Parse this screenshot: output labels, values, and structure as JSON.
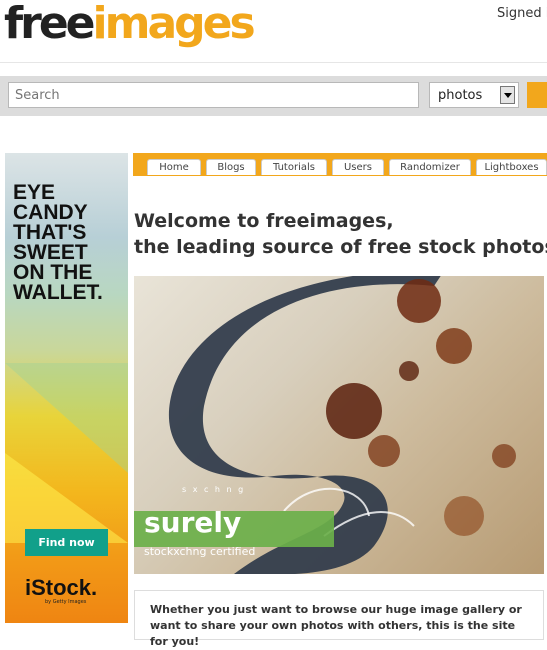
{
  "header": {
    "logo_free": "free",
    "logo_images": "images",
    "signed_in": "Signed i"
  },
  "search": {
    "placeholder": "Search",
    "type_selected": "photos"
  },
  "ad": {
    "headline": "EYE\nCANDY\nTHAT'S\nSWEET\nON THE\nWALLET.",
    "button_label": "Find now",
    "brand": "iStock.",
    "brand_sub": "by Getty Images"
  },
  "nav": {
    "tabs": [
      "Home",
      "Blogs",
      "Tutorials",
      "Users",
      "Randomizer",
      "Lightboxes"
    ]
  },
  "main": {
    "welcome_line1": "Welcome to freeimages,",
    "welcome_line2": "the leading source of free stock photos!",
    "photo_text": "surely",
    "photo_subtext": "stockxchng certified",
    "photo_small": "s x c h n g",
    "intro": "Whether you just want to browse our huge image gallery or want to share your own photos with others, this is the site for you!"
  },
  "colors": {
    "accent": "#f2a71c",
    "badge_green": "#6bb04a",
    "ad_button": "#11a08a"
  }
}
